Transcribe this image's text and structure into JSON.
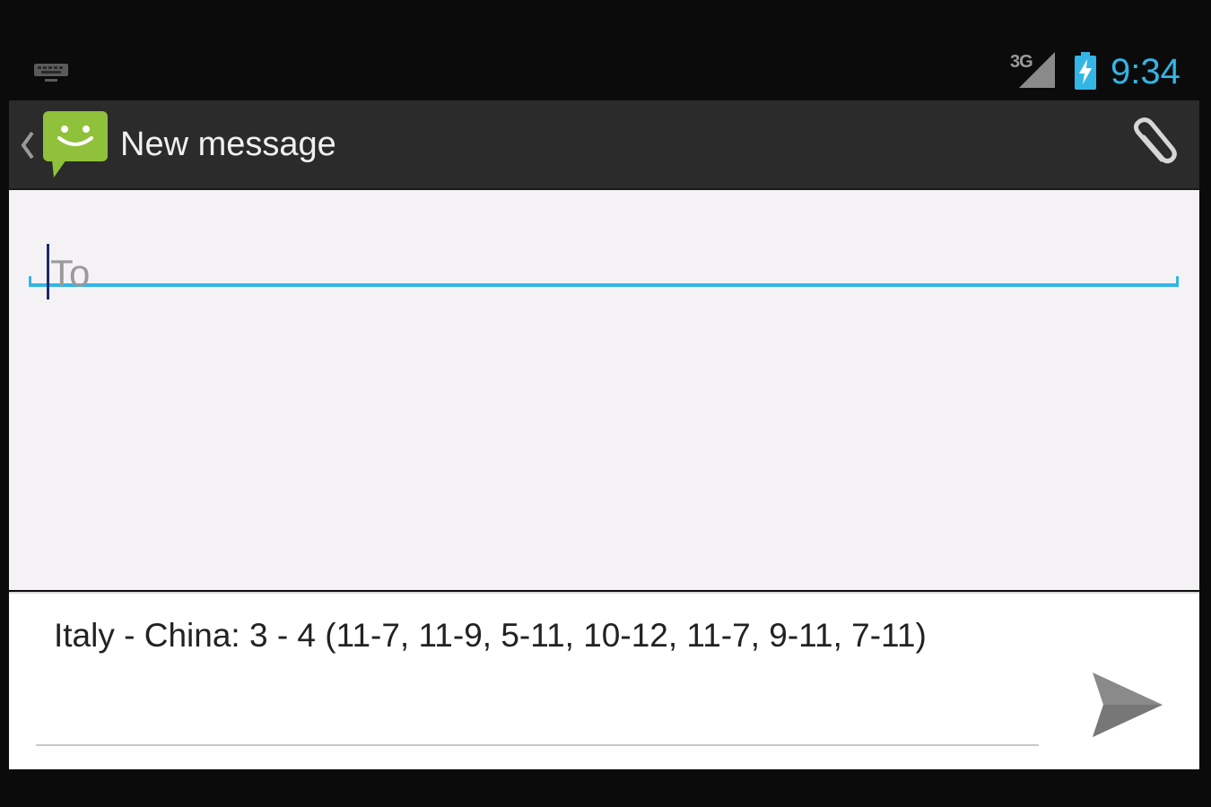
{
  "status_bar": {
    "network_type": "3G",
    "time": "9:34",
    "icons": [
      "keyboard-icon",
      "signal-icon",
      "battery-charging-icon"
    ]
  },
  "action_bar": {
    "title": "New message",
    "icons": [
      "up-caret-icon",
      "messaging-app-icon",
      "paperclip-icon"
    ]
  },
  "recipient": {
    "placeholder": "To",
    "value": ""
  },
  "compose": {
    "message": "Italy - China: 3 - 4 (11-7, 11-9, 5-11, 10-12, 11-7, 9-11, 7-11)",
    "send_icon": "send-icon"
  },
  "colors": {
    "accent": "#33b5e5",
    "app_icon_green": "#8fc13a",
    "action_bar": "#2b2b2b",
    "content_bg": "#f5f2f6"
  }
}
